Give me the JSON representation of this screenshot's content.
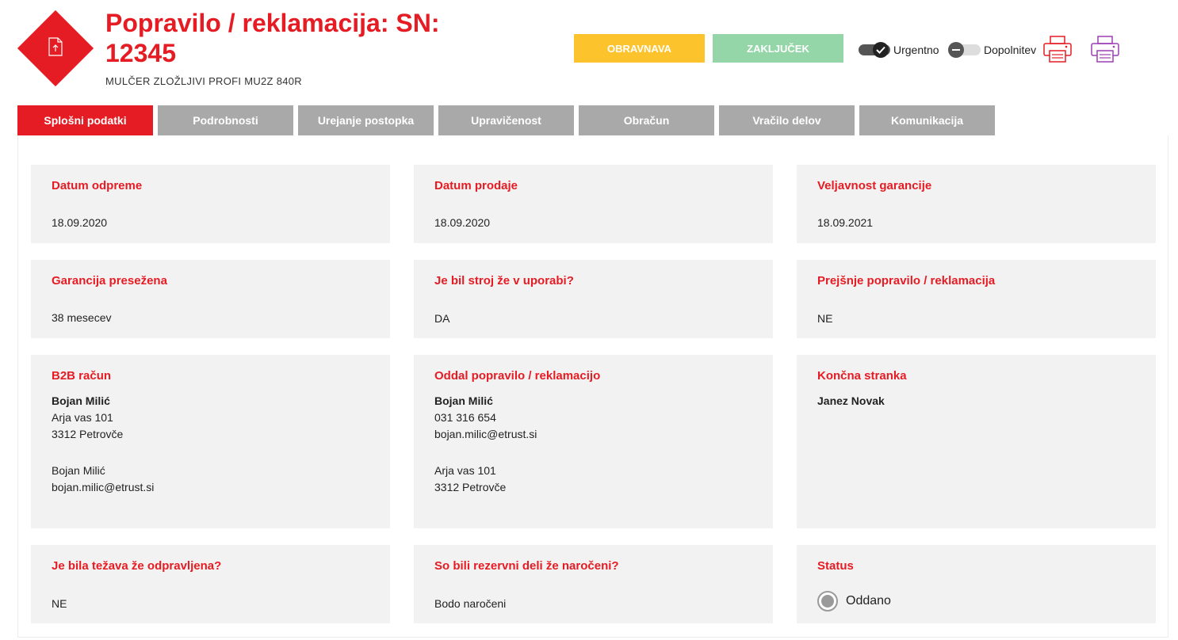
{
  "header": {
    "title": "Popravilo / reklamacija: SN: 12345",
    "subtitle": "MULČER ZLOŽLJIVI PROFI MU2Z 840R",
    "logo_icon": "upload-document-icon",
    "brand_color": "#e51c23"
  },
  "actions": {
    "obravnava_label": "OBRAVNAVA",
    "zakljucek_label": "ZAKLJUČEK",
    "urgentno": {
      "label": "Urgentno",
      "checked": true
    },
    "dopolnitev": {
      "label": "Dopolnitev",
      "checked": false
    },
    "print_icons": [
      "printer-icon",
      "printer-icon"
    ]
  },
  "tabs": [
    {
      "label": "Splošni podatki",
      "active": true
    },
    {
      "label": "Podrobnosti"
    },
    {
      "label": "Urejanje postopka"
    },
    {
      "label": "Upravičenost"
    },
    {
      "label": "Obračun"
    },
    {
      "label": "Vračilo delov"
    },
    {
      "label": "Komunikacija"
    }
  ],
  "cards": {
    "datum_odpreme": {
      "title": "Datum odpreme",
      "value": "18.09.2020"
    },
    "datum_prodaje": {
      "title": "Datum prodaje",
      "value": "18.09.2020"
    },
    "veljavnost_garancije": {
      "title": "Veljavnost garancije",
      "value": "18.09.2021"
    },
    "garancija_presezena": {
      "title": "Garancija presežena",
      "value": "38 mesecev"
    },
    "stroj_v_uporabi": {
      "title": "Je bil stroj že v uporabi?",
      "value": "DA"
    },
    "prejsnje_popravilo": {
      "title": "Prejšnje popravilo / reklamacija",
      "value": "NE"
    },
    "b2b_racun": {
      "title": "B2B račun",
      "name": "Bojan Milić",
      "street": "Arja vas 101",
      "city": "3312 Petrovče",
      "contact_name": "Bojan Milić",
      "email": "bojan.milic@etrust.si"
    },
    "oddal": {
      "title": "Oddal popravilo / reklamacijo",
      "name": "Bojan Milić",
      "phone": "031 316 654",
      "email": "bojan.milic@etrust.si",
      "street": "Arja vas 101",
      "city": "3312 Petrovče"
    },
    "koncna_stranka": {
      "title": "Končna stranka",
      "name": "Janez Novak"
    },
    "tezava_odpravljena": {
      "title": "Je bila težava že odpravljena?",
      "value": "NE"
    },
    "rezervni_deli": {
      "title": "So bili rezervni deli že naročeni?",
      "value": "Bodo naročeni"
    },
    "status": {
      "title": "Status",
      "value": "Oddano"
    }
  }
}
